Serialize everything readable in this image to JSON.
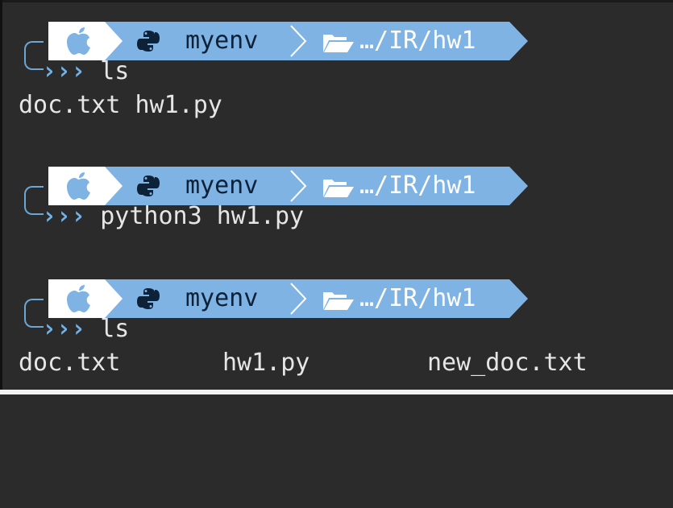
{
  "colors": {
    "background": "#2b2b2b",
    "bar_blue": "#7fb3e3",
    "bar_white": "#ffffff",
    "prompt_symbol": "#73b2e6",
    "text": "#e6e6e6"
  },
  "icons": {
    "os": "apple-icon",
    "env": "python-icon",
    "separator": "chevron-right-icon",
    "folder": "open-folder-icon"
  },
  "blocks": [
    {
      "env_name": "myenv",
      "path": "…/IR/hw1",
      "prompt_symbol": "›››",
      "command": "ls",
      "output": [
        "doc.txt hw1.py"
      ]
    },
    {
      "env_name": "myenv",
      "path": "…/IR/hw1",
      "prompt_symbol": "›››",
      "command": "python3 hw1.py",
      "output": []
    },
    {
      "env_name": "myenv",
      "path": "…/IR/hw1",
      "prompt_symbol": "›››",
      "command": "ls",
      "output": [
        "doc.txt",
        "hw1.py",
        "new_doc.txt"
      ]
    }
  ]
}
